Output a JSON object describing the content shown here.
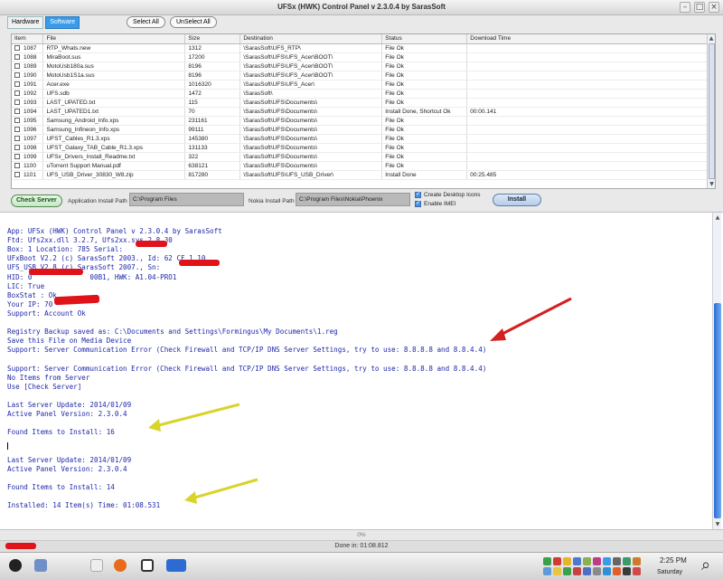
{
  "window": {
    "title": "UFSx (HWK) Control Panel v 2.3.0.4 by SarasSoft"
  },
  "tabs": [
    "Hardware",
    "Software"
  ],
  "toolbar": {
    "select_all": "Select All",
    "unselect_all": "UnSelect All"
  },
  "table": {
    "headers": [
      "Item",
      "File",
      "Size",
      "Destination",
      "Status",
      "Download Time"
    ],
    "rows": [
      [
        "1087",
        "RTP_Whats.new",
        "1312",
        "\\SarasSoft\\UFS_RTP\\",
        "File Ok",
        ""
      ],
      [
        "1088",
        "MiraBoot.sus",
        "17200",
        "\\SarasSoft\\UFS\\UFS_Acer\\BOOT\\",
        "File Ok",
        ""
      ],
      [
        "1089",
        "MotoUsb180a.sus",
        "8196",
        "\\SarasSoft\\UFS\\UFS_Acer\\BOOT\\",
        "File Ok",
        ""
      ],
      [
        "1090",
        "MotoUsb1S1a.sus",
        "8196",
        "\\SarasSoft\\UFS\\UFS_Acer\\BOOT\\",
        "File Ok",
        ""
      ],
      [
        "1091",
        "Acer.exe",
        "1016320",
        "\\SarasSoft\\UFS\\UFS_Acer\\",
        "File Ok",
        ""
      ],
      [
        "1092",
        "UFS.sdb",
        "1472",
        "\\SarasSoft\\",
        "File Ok",
        ""
      ],
      [
        "1093",
        "LAST_UPATED.txt",
        "115",
        "\\SarasSoft\\UFS\\Documents\\",
        "File Ok",
        ""
      ],
      [
        "1094",
        "LAST_UPATED1.txt",
        "70",
        "\\SarasSoft\\UFS\\Documents\\",
        "Install Done, Shortcut Ok",
        "00:00.141"
      ],
      [
        "1095",
        "Samsung_Android_Info.xps",
        "231161",
        "\\SarasSoft\\UFS\\Documents\\",
        "File Ok",
        ""
      ],
      [
        "1096",
        "Samsung_Infineon_Info.xps",
        "99111",
        "\\SarasSoft\\UFS\\Documents\\",
        "File Ok",
        ""
      ],
      [
        "1097",
        "UFST_Cables_R1.3.xps",
        "145380",
        "\\SarasSoft\\UFS\\Documents\\",
        "File Ok",
        ""
      ],
      [
        "1098",
        "UFST_Galaxy_TAB_Cable_R1.3.xps",
        "131133",
        "\\SarasSoft\\UFS\\Documents\\",
        "File Ok",
        ""
      ],
      [
        "1099",
        "UFSx_Drivers_Install_Readme.txt",
        "322",
        "\\SarasSoft\\UFS\\Documents\\",
        "File Ok",
        ""
      ],
      [
        "1100",
        "uTorrent Support Manual.pdf",
        "638121",
        "\\SarasSoft\\UFS\\Documents\\",
        "File Ok",
        ""
      ],
      [
        "1101",
        "UFS_USB_Driver_30830_W8.zip",
        "817280",
        "\\SarasSoft\\UFS\\UFS_USB_Driver\\",
        "Install Done",
        "00:25.485"
      ]
    ]
  },
  "settings": {
    "check_server": "Check Server",
    "app_path_label": "Application Install Path",
    "app_path_value": "C:\\Program Files",
    "nokia_path_label": "Nokia Install Path",
    "nokia_path_value": "C:\\Program Files\\Nokia\\Phoenix",
    "create_icons": "Create Desktop Icons",
    "enable_imei": "Enable IMEI",
    "install": "Install"
  },
  "log": [
    {
      "t": "App: UFSx (HWK) Control Panel v 2.3.0.4 by SarasSoft"
    },
    {
      "t": "Ftd: Ufs2xx.dll 3.2.7, Ufs2xx.sys 2.8.30"
    },
    {
      "t": "Box: 1 Location: 785 Serial: "
    },
    {
      "t": "UFxBoot V2.2 (c) SarasSoft 2003., Id: 62 CF 1 10"
    },
    {
      "t": "UFS_USB V2.8 (c) SarasSoft 2007., Sn: "
    },
    {
      "t": "HID: 0              00B1, HWK: A1.04-PRO1"
    },
    {
      "t": "LIC: True"
    },
    {
      "t": "BoxStat : Ok"
    },
    {
      "t": "Your IP: 70"
    },
    {
      "t": "Support: Account Ok"
    },
    {
      "t": ""
    },
    {
      "t": "Registry Backup saved as: C:\\Documents and Settings\\Formingus\\My Documents\\1.reg"
    },
    {
      "t": "Save this File on Media Device"
    },
    {
      "t": "Support: Server Communication Error (Check Firewall and TCP/IP DNS Server Settings, try to use: 8.8.8.8 and 8.8.4.4)"
    },
    {
      "t": ""
    },
    {
      "t": "Support: Server Communication Error (Check Firewall and TCP/IP DNS Server Settings, try to use: 8.8.8.8 and 8.8.4.4)"
    },
    {
      "t": "No Items from Server"
    },
    {
      "t": "Use [Check Server]"
    },
    {
      "t": ""
    },
    {
      "t": "Last Server Update: 2014/01/09"
    },
    {
      "t": "Active Panel Version: 2.3.0.4"
    },
    {
      "t": ""
    },
    {
      "t": "Found Items to Install: 16"
    },
    {
      "t": ""
    },
    {
      "t": ""
    },
    {
      "t": "Last Server Update: 2014/01/09"
    },
    {
      "t": "Active Panel Version: 2.3.0.4"
    },
    {
      "t": ""
    },
    {
      "t": "Found Items to Install: 14"
    },
    {
      "t": ""
    },
    {
      "t": "Installed: 14 Item(s) Time: 01:08.531"
    }
  ],
  "progress": {
    "text": "0%",
    "value": 0
  },
  "status": {
    "done": "Done in: 01:08.812"
  },
  "taskbar": {
    "time": "2:25 PM",
    "day": "Saturday"
  },
  "colors": {
    "log_text": "#1d27a8",
    "tab_active": "#3a9be8",
    "redaction": "#e0121a",
    "arrow_red": "#d32020",
    "arrow_yellow": "#d8d42a"
  }
}
